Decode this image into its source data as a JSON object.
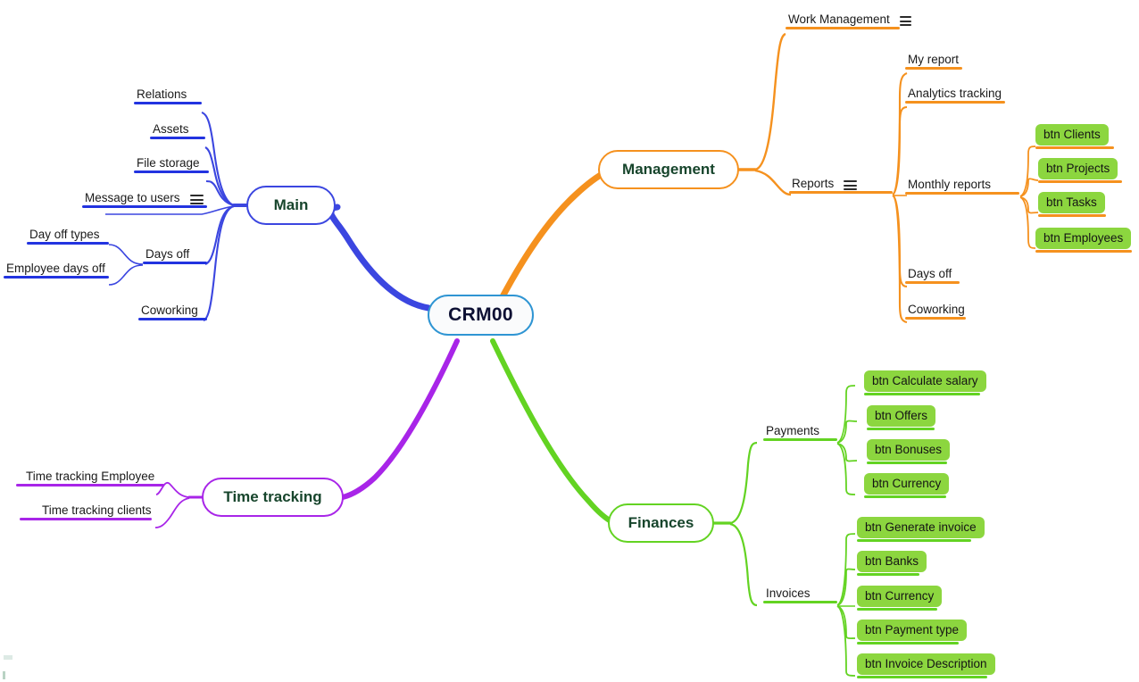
{
  "diagram": {
    "type": "mind-map",
    "title": "CRM00",
    "colors": {
      "root": "#2f95d3",
      "main_branch": "#3b46e0",
      "management_branch": "#f5911e",
      "finances_branch": "#63d322",
      "time_tracking_branch": "#a825e8",
      "chip_fill": "#8cd63f",
      "label_text": "#1a1a1a",
      "branch_text": "#17452c"
    }
  },
  "root": {
    "label": "CRM00"
  },
  "branches": {
    "main": {
      "label": "Main",
      "color": "#3b46e0",
      "topics": [
        {
          "label": "Relations",
          "menu": false
        },
        {
          "label": "Assets",
          "menu": false
        },
        {
          "label": "File storage",
          "menu": false
        },
        {
          "label": "Message to users",
          "menu": true
        },
        {
          "label": "Days off",
          "menu": false
        },
        {
          "label": "Coworking",
          "menu": false
        }
      ],
      "days_off_children": [
        {
          "label": "Day off types"
        },
        {
          "label": "Employee days off"
        }
      ]
    },
    "management": {
      "label": "Management",
      "color": "#f5911e",
      "topics": [
        {
          "label": "Work Management",
          "menu": true
        },
        {
          "label": "Reports",
          "menu": true
        }
      ],
      "reports_children": [
        {
          "label": "My report"
        },
        {
          "label": "Analytics tracking"
        },
        {
          "label": "Monthly reports"
        },
        {
          "label": "Days off"
        },
        {
          "label": "Coworking"
        }
      ],
      "monthly_reports_buttons": [
        {
          "label": "btn Clients"
        },
        {
          "label": "btn Projects"
        },
        {
          "label": "btn Tasks"
        },
        {
          "label": "btn Employees"
        }
      ]
    },
    "finances": {
      "label": "Finances",
      "color": "#63d322",
      "topics": [
        {
          "label": "Payments"
        },
        {
          "label": "Invoices"
        }
      ],
      "payments_buttons": [
        {
          "label": "btn Calculate salary"
        },
        {
          "label": "btn Offers"
        },
        {
          "label": "btn Bonuses"
        },
        {
          "label": "btn Currency"
        }
      ],
      "invoices_buttons": [
        {
          "label": "btn Generate invoice"
        },
        {
          "label": "btn Banks"
        },
        {
          "label": "btn Currency"
        },
        {
          "label": "btn Payment type"
        },
        {
          "label": "btn Invoice Description"
        }
      ]
    },
    "time_tracking": {
      "label": "Time tracking",
      "color": "#a825e8",
      "topics": [
        {
          "label": "Time tracking Employee"
        },
        {
          "label": "Time tracking clients"
        }
      ]
    }
  }
}
